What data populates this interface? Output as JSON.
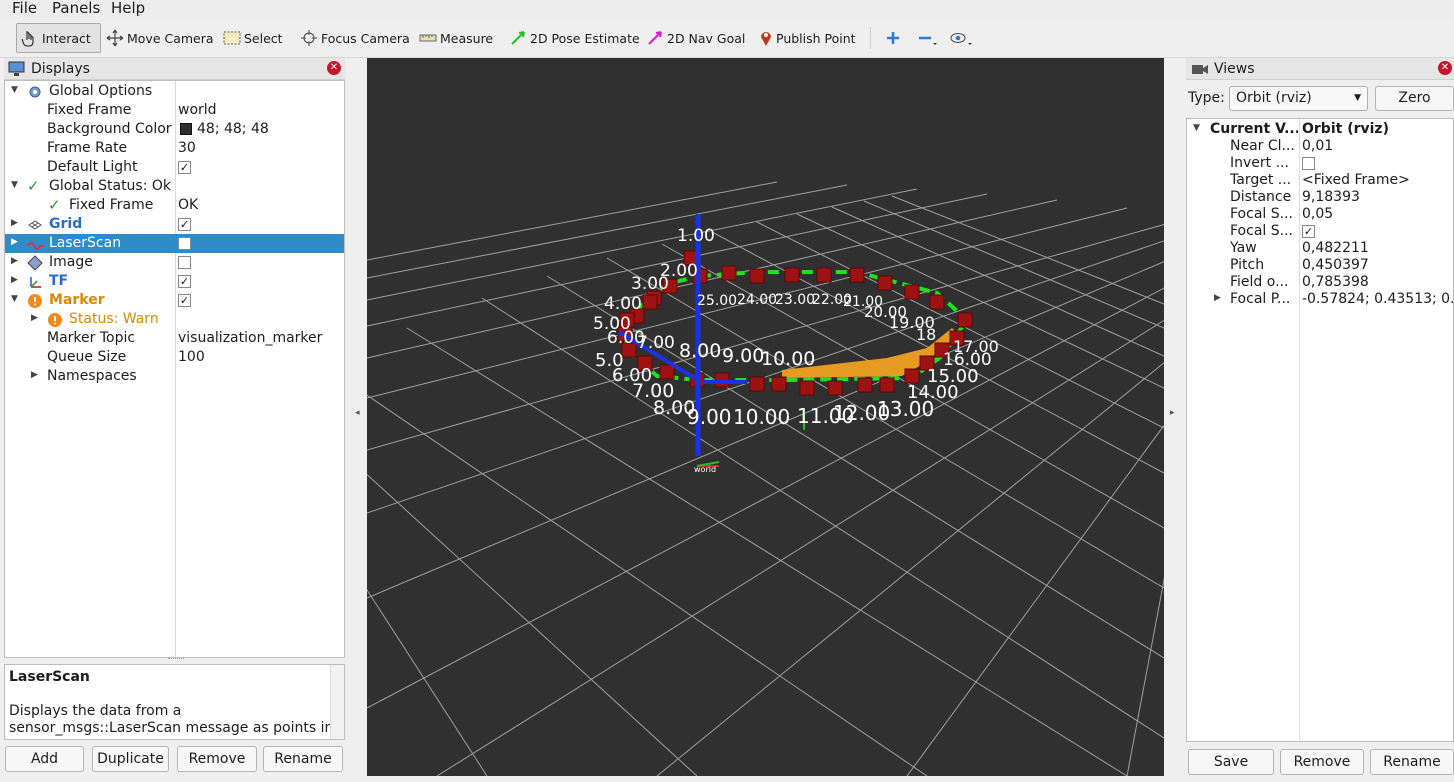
{
  "menu": [
    "File",
    "Panels",
    "Help"
  ],
  "toolbar": {
    "tools": [
      "Interact",
      "Move Camera",
      "Select",
      "Focus Camera",
      "Measure",
      "2D Pose Estimate",
      "2D Nav Goal",
      "Publish Point"
    ]
  },
  "displays": {
    "title": "Displays",
    "rows": {
      "global_options": "Global Options",
      "fixed_frame": {
        "label": "Fixed Frame",
        "value": "world"
      },
      "background_color": {
        "label": "Background Color",
        "value": "48; 48; 48",
        "swatch": "#303030"
      },
      "frame_rate": {
        "label": "Frame Rate",
        "value": "30"
      },
      "default_light": {
        "label": "Default Light",
        "checked": true
      },
      "global_status": "Global Status: Ok",
      "status_fixed_frame": {
        "label": "Fixed Frame",
        "value": "OK"
      },
      "grid": {
        "label": "Grid",
        "checked": true
      },
      "laserscan": {
        "label": "LaserScan",
        "checked": false
      },
      "image": {
        "label": "Image",
        "checked": false
      },
      "tf": {
        "label": "TF",
        "checked": true
      },
      "marker": {
        "label": "Marker",
        "checked": true
      },
      "marker_status": "Status: Warn",
      "marker_topic": {
        "label": "Marker Topic",
        "value": "visualization_marker"
      },
      "queue_size": {
        "label": "Queue Size",
        "value": "100"
      },
      "namespaces": "Namespaces"
    },
    "description": {
      "title": "LaserScan",
      "line1": "Displays the data from a",
      "line2": "sensor_msgs::LaserScan message as points in"
    },
    "buttons": {
      "add": "Add",
      "duplicate": "Duplicate",
      "remove": "Remove",
      "rename": "Rename"
    }
  },
  "viewport": {
    "background": "#303030",
    "labels": {
      "l1": "1.00",
      "l2": "2.00",
      "l3": "3.00",
      "l4": "4.00",
      "l5": "5.00",
      "l6": "6.00",
      "l7": "7.00",
      "l8": "8.00",
      "l9": "9.00",
      "l10": "10.00",
      "l25": "25.00",
      "l24": "24.00",
      "l23": "23.00",
      "l22": "22.00",
      "l21": "21.00",
      "l20": "20.00",
      "l19": "19.00",
      "l18": "18",
      "l17": "17.00",
      "l16": "16.00",
      "l15": "15.00",
      "l14": "14.00",
      "l13": "13.00",
      "l12": "12.00",
      "l11": "11.00",
      "lb7": "7.00",
      "lb8": "8.00",
      "lb9": "9.00",
      "lb10": "10.00",
      "lb6": "6.00",
      "lb5": "5.0",
      "world": "world"
    }
  },
  "views": {
    "title": "Views",
    "type_label": "Type:",
    "type_value": "Orbit (rviz)",
    "zero_label": "Zero",
    "header": {
      "key": "Current V...",
      "value": "Orbit (rviz)"
    },
    "props": [
      {
        "key": "Near Cl...",
        "value": "0,01"
      },
      {
        "key": "Invert ...",
        "value": ""
      },
      {
        "key": "Target ...",
        "value": "<Fixed Frame>"
      },
      {
        "key": "Distance",
        "value": "9,18393"
      },
      {
        "key": "Focal S...",
        "value": "0,05"
      },
      {
        "key": "Focal S...",
        "value": ""
      },
      {
        "key": "Yaw",
        "value": "0,482211"
      },
      {
        "key": "Pitch",
        "value": "0,450397"
      },
      {
        "key": "Field o...",
        "value": "0,785398"
      },
      {
        "key": "Focal P...",
        "value": "-0.57824; 0.43513; 0..."
      }
    ],
    "buttons": {
      "save": "Save",
      "remove": "Remove",
      "rename": "Rename"
    }
  }
}
